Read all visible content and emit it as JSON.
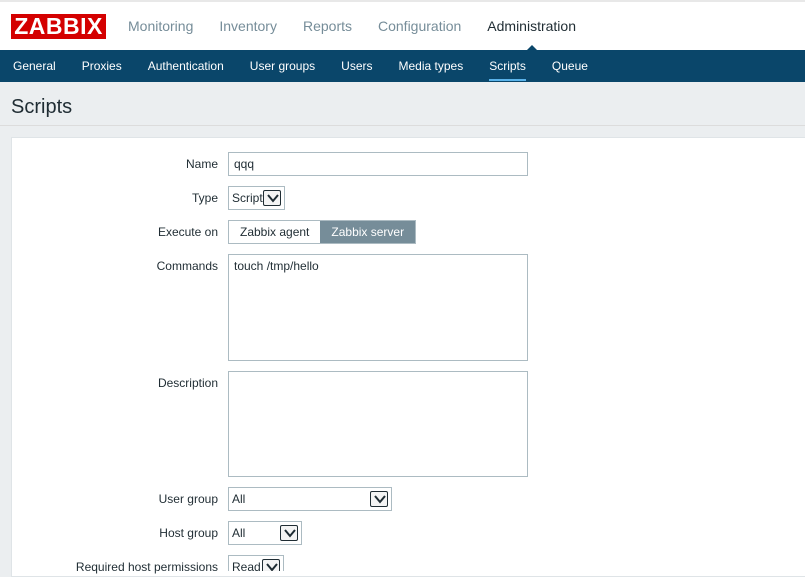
{
  "logo": "ZABBIX",
  "main_menu": [
    {
      "label": "Monitoring",
      "active": false
    },
    {
      "label": "Inventory",
      "active": false
    },
    {
      "label": "Reports",
      "active": false
    },
    {
      "label": "Configuration",
      "active": false
    },
    {
      "label": "Administration",
      "active": true
    }
  ],
  "sub_menu": [
    {
      "label": "General",
      "active": false
    },
    {
      "label": "Proxies",
      "active": false
    },
    {
      "label": "Authentication",
      "active": false
    },
    {
      "label": "User groups",
      "active": false
    },
    {
      "label": "Users",
      "active": false
    },
    {
      "label": "Media types",
      "active": false
    },
    {
      "label": "Scripts",
      "active": true
    },
    {
      "label": "Queue",
      "active": false
    }
  ],
  "page_title": "Scripts",
  "form": {
    "name_label": "Name",
    "name_value": "qqq",
    "type_label": "Type",
    "type_value": "Script",
    "execute_on_label": "Execute on",
    "execute_on_options": [
      "Zabbix agent",
      "Zabbix server"
    ],
    "execute_on_selected": "Zabbix server",
    "commands_label": "Commands",
    "commands_value": "touch /tmp/hello",
    "description_label": "Description",
    "description_value": "",
    "user_group_label": "User group",
    "user_group_value": "All",
    "host_group_label": "Host group",
    "host_group_value": "All",
    "permissions_label": "Required host permissions",
    "permissions_value": "Read"
  },
  "colors": {
    "brand_red": "#d40000",
    "nav_blue": "#0a466a",
    "selected_gray": "#768d99",
    "active_underline": "#5ab3ea"
  }
}
